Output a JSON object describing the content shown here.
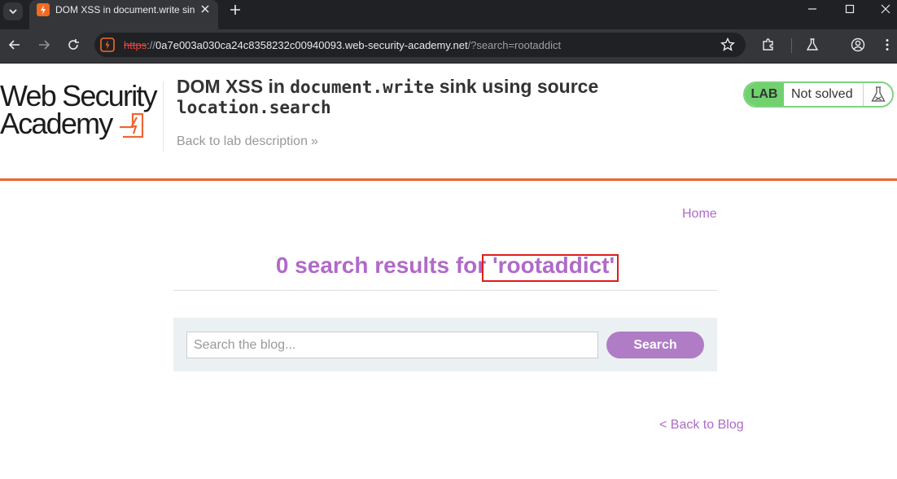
{
  "browser": {
    "tab_title": "DOM XSS in document.write sink using source location.search",
    "url_scheme": "https",
    "url_sep": "://",
    "url_host": "0a7e003a030ca24c8358232c00940093.web-security-academy.net",
    "url_path": "/?search=rootaddict"
  },
  "logo": {
    "line1": "Web Security",
    "line2": "Academy"
  },
  "lab": {
    "title_pre": "DOM XSS in ",
    "title_code1": "document.write",
    "title_mid": " sink using source ",
    "title_code2": "location.search",
    "back_link": "Back to lab description",
    "back_chevron": "»",
    "badge": "LAB",
    "status": "Not solved"
  },
  "nav": {
    "home": "Home"
  },
  "results": {
    "prefix": "0 search results for ",
    "query": "'rootaddict'"
  },
  "search": {
    "placeholder": "Search the blog...",
    "button": "Search"
  },
  "footer": {
    "back_blog": "< Back to Blog"
  },
  "colors": {
    "accent_orange": "#ee6633",
    "link_purple": "#b06ac8",
    "lab_green": "#70d16e",
    "highlight_red": "#e01b1b"
  }
}
